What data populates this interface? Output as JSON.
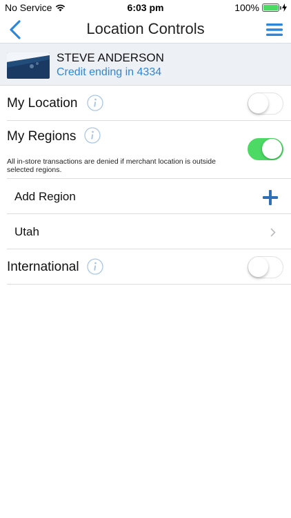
{
  "status_bar": {
    "carrier": "No Service",
    "time": "6:03 pm",
    "battery": "100%",
    "battery_level": 1.0
  },
  "nav": {
    "title": "Location Controls",
    "back_icon": "chevron-left-icon",
    "menu_icon": "hamburger-menu-icon"
  },
  "card": {
    "holder_name": "STEVE ANDERSON",
    "subtitle": "Credit ending in 4334"
  },
  "settings": {
    "my_location": {
      "label": "My Location",
      "enabled": false
    },
    "my_regions": {
      "label": "My Regions",
      "enabled": true,
      "note": "All in-store transactions are denied if merchant location is outside selected regions."
    },
    "add_region": {
      "label": "Add Region"
    },
    "regions": [
      {
        "label": "Utah"
      }
    ],
    "international": {
      "label": "International",
      "enabled": false
    }
  },
  "colors": {
    "accent_blue": "#2f86d6",
    "toggle_on": "#4cd964",
    "header_bg": "#edf1f6"
  }
}
